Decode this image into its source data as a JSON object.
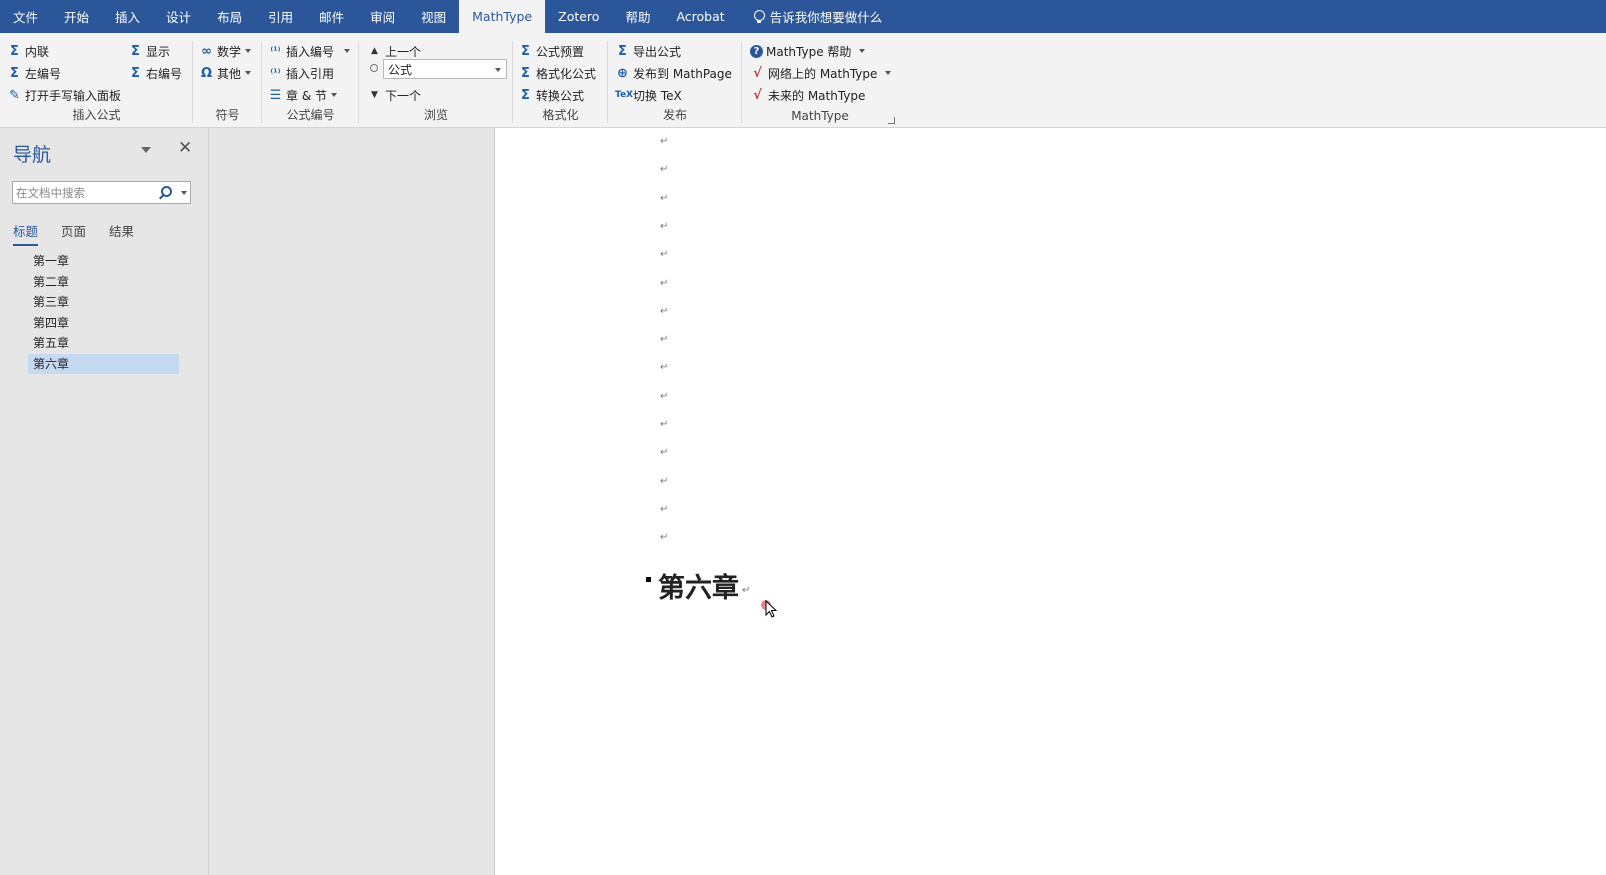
{
  "tabs": [
    "文件",
    "开始",
    "插入",
    "设计",
    "布局",
    "引用",
    "邮件",
    "审阅",
    "视图",
    "MathType",
    "Zotero",
    "帮助",
    "Acrobat"
  ],
  "tell_me": "告诉我你想要做什么",
  "groups": {
    "insert_eq": {
      "label": "插入公式",
      "inline": "内联",
      "display": "显示",
      "left_num": "左编号",
      "right_num": "右编号",
      "handwrite": "打开手写输入面板"
    },
    "symbols": {
      "label": "符号",
      "math": "数学",
      "other": "其他"
    },
    "eqnum": {
      "label": "公式编号",
      "insert_num": "插入编号",
      "insert_ref": "插入引用",
      "chapter": "章 & 节"
    },
    "browse": {
      "label": "浏览",
      "prev": "上一个",
      "combo_value": "公式",
      "next": "下一个"
    },
    "format": {
      "label": "格式化",
      "preset": "公式预置",
      "format_eq": "格式化公式",
      "convert": "转换公式"
    },
    "publish": {
      "label": "发布",
      "export": "导出公式",
      "mathpage": "发布到 MathPage",
      "toggle_tex": "切换 TeX"
    },
    "mathtype": {
      "label": "MathType",
      "help": "MathType 帮助",
      "online": "网络上的 MathType",
      "future": "未来的 MathType"
    }
  },
  "nav": {
    "title": "导航",
    "search_placeholder": "在文档中搜索",
    "tabs": [
      "标题",
      "页面",
      "结果"
    ],
    "headings": [
      "第一章",
      "第二章",
      "第三章",
      "第四章",
      "第五章",
      "第六章"
    ],
    "selected_heading": "第六章"
  },
  "document": {
    "paragraph_mark": "↵",
    "heading": "第六章"
  },
  "colors": {
    "accent": "#2b579a",
    "selection": "#c5d9f1"
  }
}
